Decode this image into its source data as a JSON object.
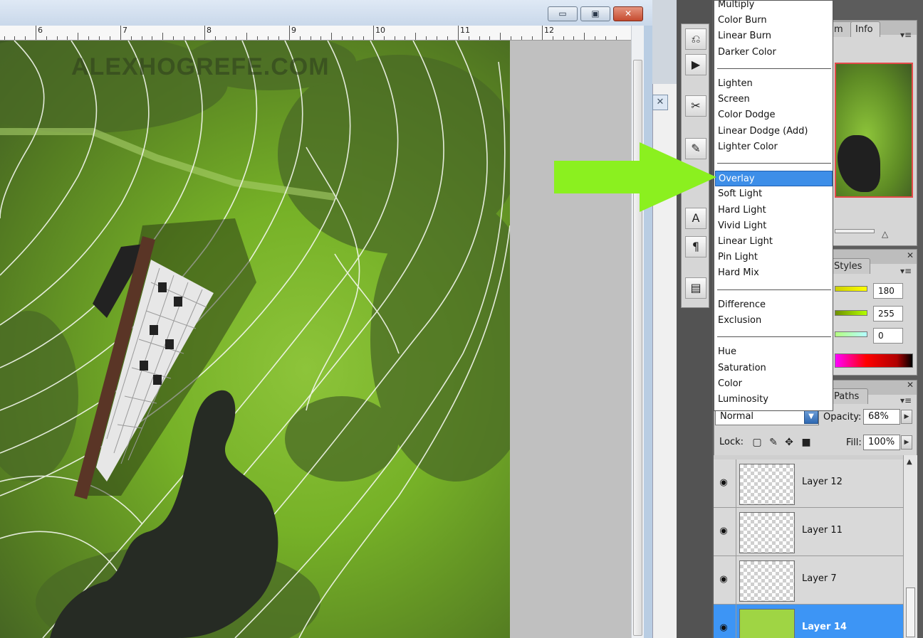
{
  "window_controls": {
    "minimize_icon": "minimize-icon",
    "maximize_icon": "restore-icon",
    "close_icon": "close-icon",
    "minimize_glyph": "▭",
    "maximize_glyph": "▣",
    "close_glyph": "✕"
  },
  "ruler": {
    "labels": [
      "6",
      "7",
      "8",
      "9",
      "10",
      "11",
      "12"
    ]
  },
  "canvas": {
    "watermark": "ALEXHOGREFE.COM"
  },
  "sliver": {
    "close_glyph": "✕"
  },
  "dock": {
    "icons": [
      "history-icon",
      "actions-icon",
      "tool-presets-icon",
      "brushes-icon",
      "character-icon",
      "paragraph-icon",
      "layer-comps-icon"
    ],
    "glyphs": [
      "⎌",
      "▶",
      "✂",
      "✎",
      "A",
      "¶",
      "▤"
    ]
  },
  "panels": {
    "navigator_tabs": [
      "m",
      "Info"
    ],
    "styles_tab": "Styles",
    "paths_tab": "Paths",
    "close_glyph": "✕",
    "menu_glyph": "▾≡",
    "color_values": [
      "180",
      "255",
      "0"
    ]
  },
  "blend_modes": {
    "groups": [
      [
        "Multiply",
        "Color Burn",
        "Linear Burn",
        "Darker Color"
      ],
      [
        "Lighten",
        "Screen",
        "Color Dodge",
        "Linear Dodge (Add)",
        "Lighter Color"
      ],
      [
        "Overlay",
        "Soft Light",
        "Hard Light",
        "Vivid Light",
        "Linear Light",
        "Pin Light",
        "Hard Mix"
      ],
      [
        "Difference",
        "Exclusion"
      ],
      [
        "Hue",
        "Saturation",
        "Color",
        "Luminosity"
      ]
    ],
    "highlighted": "Overlay"
  },
  "layers_panel": {
    "blend_mode_value": "Normal",
    "opacity_label": "Opacity:",
    "opacity_value": "68%",
    "lock_label": "Lock:",
    "fill_label": "Fill:",
    "fill_value": "100%",
    "lock_icons": [
      "lock-transparent-icon",
      "lock-image-icon",
      "lock-position-icon",
      "lock-all-icon"
    ],
    "layers": [
      {
        "name": "Layer 12",
        "visible": true,
        "selected": false
      },
      {
        "name": "Layer 11",
        "visible": true,
        "selected": false
      },
      {
        "name": "Layer 7",
        "visible": true,
        "selected": false
      },
      {
        "name": "Layer 14",
        "visible": true,
        "selected": true
      }
    ]
  },
  "colors": {
    "accent_arrow": "#8bf01f",
    "selection": "#3d95f5",
    "menu_highlight": "#3d8ee8"
  }
}
